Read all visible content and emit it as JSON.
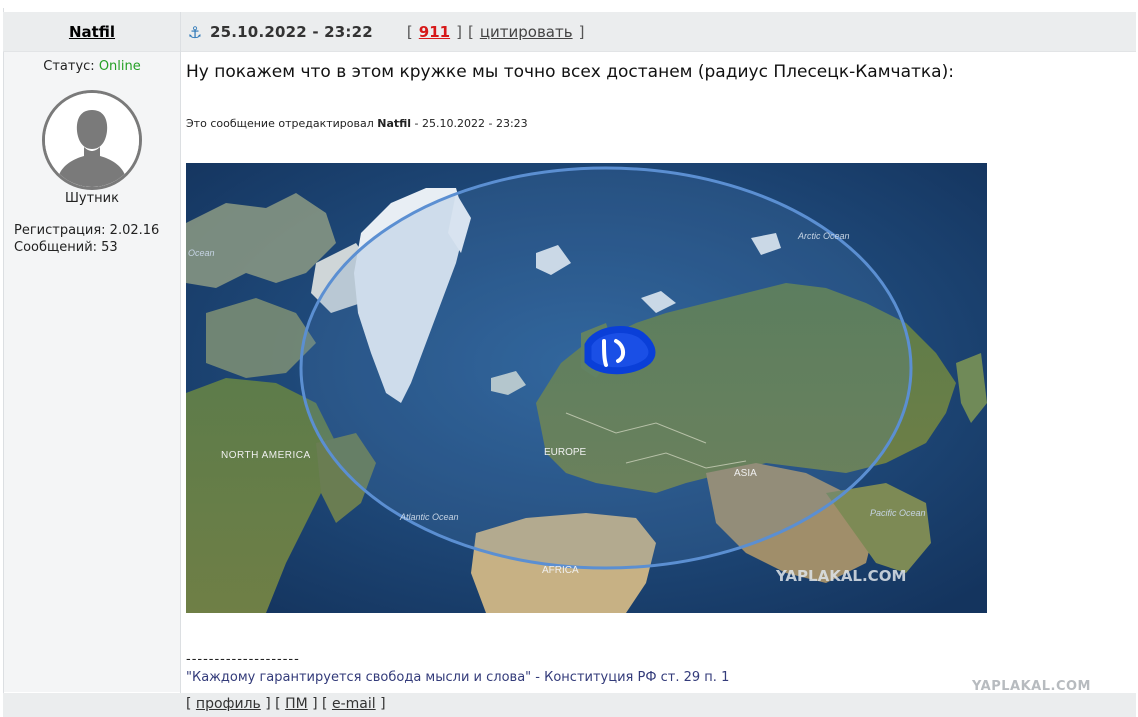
{
  "author": {
    "name": "Natfil",
    "status_label": "Статус:",
    "status_value": "Online",
    "rank": "Шутник",
    "registration": "Регистрация: 2.02.16",
    "messages": "Сообщений: 53"
  },
  "post": {
    "date": "25.10.2022 - 23:22",
    "rating": "911",
    "quote_label": "цитировать",
    "text": "Ну покажем что в этом кружке мы точно всех достанем (радиус Плесецк-Камчатка):",
    "edited_prefix": "Это сообщение отредактировал",
    "edited_author": "Natfil",
    "edited_suffix": " - 25.10.2022 - 23:23",
    "icon": "anchor-icon"
  },
  "map": {
    "labels": {
      "north_america": "NORTH AMERICA",
      "europe": "EUROPE",
      "asia": "ASIA",
      "africa": "AFRICA",
      "arctic_ocean": "Arctic Ocean",
      "atlantic_ocean": "Atlantic Ocean",
      "pacific_ocean": "Pacific Ocean",
      "ocean_left": "Ocean",
      "watermark": "YAPLAKAL.COM"
    }
  },
  "signature": {
    "dashes": "--------------------",
    "quote": "\"Каждому гарантируется свобода мысли и слова\"",
    "source": " - Конституция РФ ст. 29 п. 1"
  },
  "footer": {
    "profile": "профиль",
    "pm": "ПМ",
    "email": "e-mail"
  },
  "page_watermark": "YAPLAKAL.COM",
  "colors": {
    "online": "#25a025",
    "rating": "#d71919",
    "signature": "#333b7a",
    "header_bg": "#ebedee"
  }
}
